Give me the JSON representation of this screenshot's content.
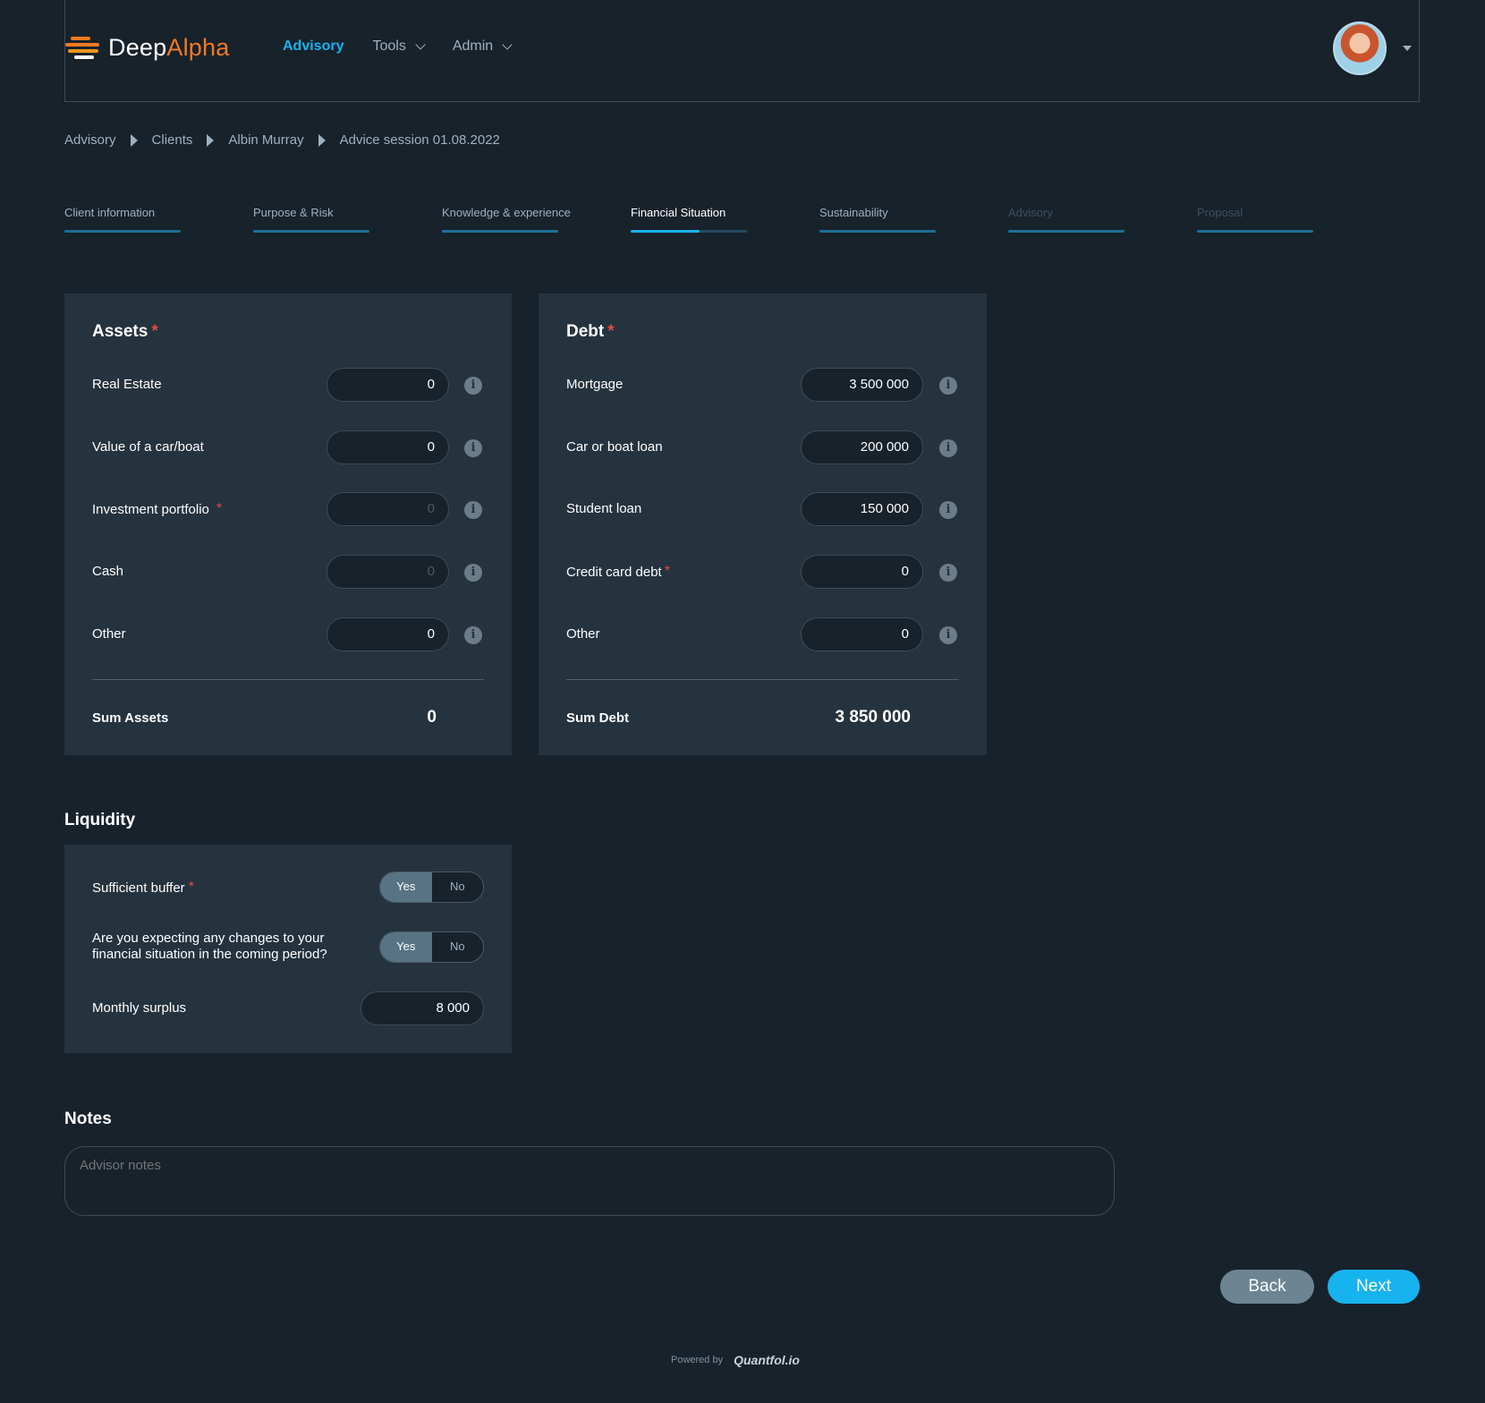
{
  "brand": {
    "name_part1": "Deep",
    "name_part2": "Alpha"
  },
  "nav": [
    {
      "label": "Advisory",
      "active": true
    },
    {
      "label": "Tools",
      "dropdown": true
    },
    {
      "label": "Admin",
      "dropdown": true
    }
  ],
  "breadcrumb": [
    "Advisory",
    "Clients",
    "Albin Murray",
    "Advice session 01.08.2022"
  ],
  "steps": [
    {
      "label": "Client information",
      "state": "done"
    },
    {
      "label": "Purpose & Risk",
      "state": "done"
    },
    {
      "label": "Knowledge & experience",
      "state": "done"
    },
    {
      "label": "Financial Situation",
      "state": "active",
      "progress": 0.6
    },
    {
      "label": "Sustainability",
      "state": "done"
    },
    {
      "label": "Advisory",
      "state": "disabled"
    },
    {
      "label": "Proposal",
      "state": "disabled"
    }
  ],
  "assets": {
    "title": "Assets",
    "required_mark": "*",
    "rows": [
      {
        "label": "Real Estate",
        "value": "0"
      },
      {
        "label": "Value of a car/boat",
        "value": "0"
      },
      {
        "label": "Investment portfolio",
        "value": "0",
        "required": true,
        "placeholder": true
      },
      {
        "label": "Cash",
        "value": "0",
        "placeholder": true
      },
      {
        "label": "Other",
        "value": "0"
      }
    ],
    "sum_label": "Sum Assets",
    "sum_value": "0"
  },
  "debt": {
    "title": "Debt",
    "required_mark": "*",
    "rows": [
      {
        "label": "Mortgage",
        "value": "3 500 000"
      },
      {
        "label": "Car or boat loan",
        "value": "200 000"
      },
      {
        "label": "Student loan",
        "value": "150 000"
      },
      {
        "label": "Credit card debt",
        "value": "0",
        "required": true
      },
      {
        "label": "Other",
        "value": "0"
      }
    ],
    "sum_label": "Sum Debt",
    "sum_value": "3 850 000"
  },
  "info_glyph": "i",
  "liquidity": {
    "title": "Liquidity",
    "buffer_label": "Sufficient buffer",
    "changes_label_line1": "Are you expecting any changes to your",
    "changes_label_line2": "financial situation in the coming period?",
    "yes": "Yes",
    "no": "No",
    "surplus_label": "Monthly surplus",
    "surplus_value": "8 000"
  },
  "notes": {
    "title": "Notes",
    "placeholder": "Advisor notes"
  },
  "buttons": {
    "back": "Back",
    "next": "Next"
  },
  "footer": {
    "powered_by": "Powered by",
    "brand": "Quantfol.io"
  },
  "colors": {
    "accent": "#17b3ee",
    "brand_orange": "#f47a1f",
    "required": "#e34848"
  }
}
